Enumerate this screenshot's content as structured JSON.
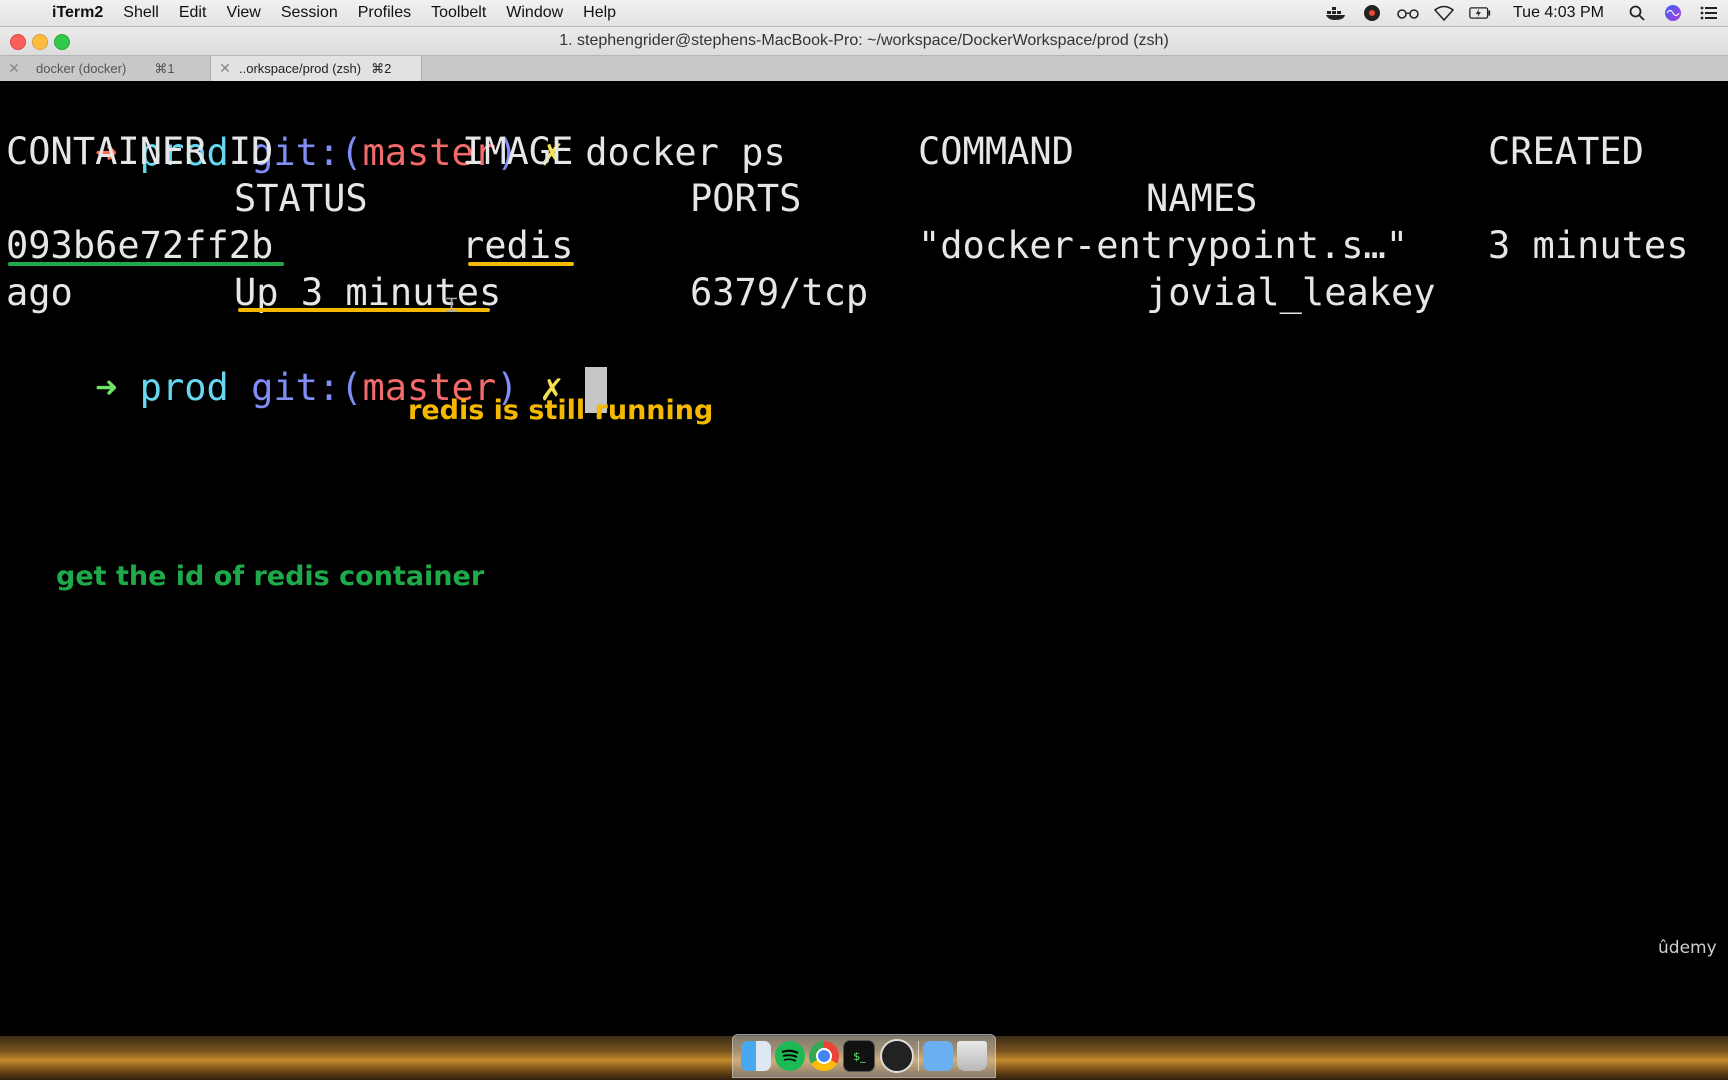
{
  "menubar": {
    "apple_icon": "apple-icon",
    "app_name": "iTerm2",
    "items": [
      "Shell",
      "Edit",
      "View",
      "Session",
      "Profiles",
      "Toolbelt",
      "Window",
      "Help"
    ],
    "status_icons": [
      "docker-icon",
      "screen-recorder-icon",
      "glasses-icon",
      "wifi-icon",
      "battery-icon"
    ],
    "clock": "Tue 4:03 PM",
    "right_icons": [
      "search-icon",
      "siri-icon",
      "notification-list-icon"
    ]
  },
  "window": {
    "title": "1. stephengrider@stephens-MacBook-Pro: ~/workspace/DockerWorkspace/prod (zsh)"
  },
  "tabs": [
    {
      "label": "docker (docker)",
      "shortcut": "⌘1",
      "active": false
    },
    {
      "label": "..orkspace/prod (zsh)",
      "shortcut": "⌘2",
      "active": true
    }
  ],
  "terminal": {
    "prompt": {
      "arrow": "➜",
      "dir": "prod",
      "git_prefix": "git:(",
      "branch": "master",
      "git_suffix": ")",
      "dirty_mark": "✗"
    },
    "command": "docker ps",
    "headers_row1": {
      "container_id": "CONTAINER ID",
      "image": "IMAGE",
      "command": "COMMAND",
      "created": "CREATED"
    },
    "headers_row2": {
      "status": "STATUS",
      "ports": "PORTS",
      "names": "NAMES"
    },
    "row1": {
      "container_id": "093b6e72ff2b",
      "image": "redis",
      "command": "\"docker-entrypoint.s…\"",
      "created": "3 minutes"
    },
    "row2": {
      "created_cont": "ago",
      "status": "Up 3 minutes",
      "ports": "6379/tcp",
      "names": "jovial_leakey"
    }
  },
  "annotations": {
    "redis_running": "redis is still running",
    "get_id": "get the id of redis container"
  },
  "colors": {
    "annotation_orange": "#f5b800",
    "annotation_green": "#1faa4a",
    "underline_green": "#1faa4a",
    "underline_orange": "#f5b800"
  },
  "watermark": "ûdemy",
  "dock": {
    "icons": [
      "finder-icon",
      "spotify-icon",
      "chrome-icon",
      "terminal-icon",
      "obs-icon",
      "folder-icon",
      "trash-icon"
    ]
  }
}
